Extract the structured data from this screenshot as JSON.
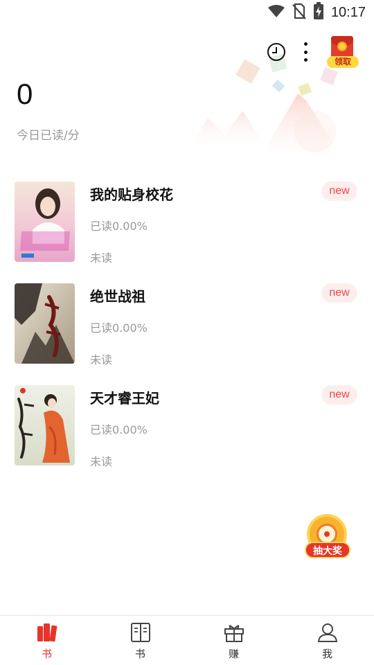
{
  "status_bar": {
    "time": "10:17",
    "icons": [
      "wifi-icon",
      "no-sim-icon",
      "battery-charging-icon"
    ]
  },
  "header": {
    "icons": [
      "history-clock-icon",
      "more-vertical-icon",
      "red-packet-icon"
    ],
    "red_packet_label": "领取"
  },
  "stats": {
    "today_read_minutes": "0",
    "today_read_label": "今日已读/分"
  },
  "books": [
    {
      "title": "我的贴身校花",
      "progress": "已读0.00%",
      "status": "未读",
      "badge": "new"
    },
    {
      "title": "绝世战祖",
      "progress": "已读0.00%",
      "status": "未读",
      "badge": "new"
    },
    {
      "title": "天才睿王妃",
      "progress": "已读0.00%",
      "status": "未读",
      "badge": "new"
    }
  ],
  "lottery": {
    "label": "抽大奖"
  },
  "tabs": [
    {
      "label": "书",
      "icon": "bookshelf-icon",
      "active": true
    },
    {
      "label": "书",
      "icon": "open-book-icon",
      "active": false
    },
    {
      "label": "赚",
      "icon": "gift-icon",
      "active": false
    },
    {
      "label": "我",
      "icon": "user-icon",
      "active": false
    }
  ],
  "colors": {
    "accent": "#e8332b",
    "badge_bg": "#fdeeee",
    "badge_text": "#e84a4a",
    "secondary_text": "#999999"
  }
}
